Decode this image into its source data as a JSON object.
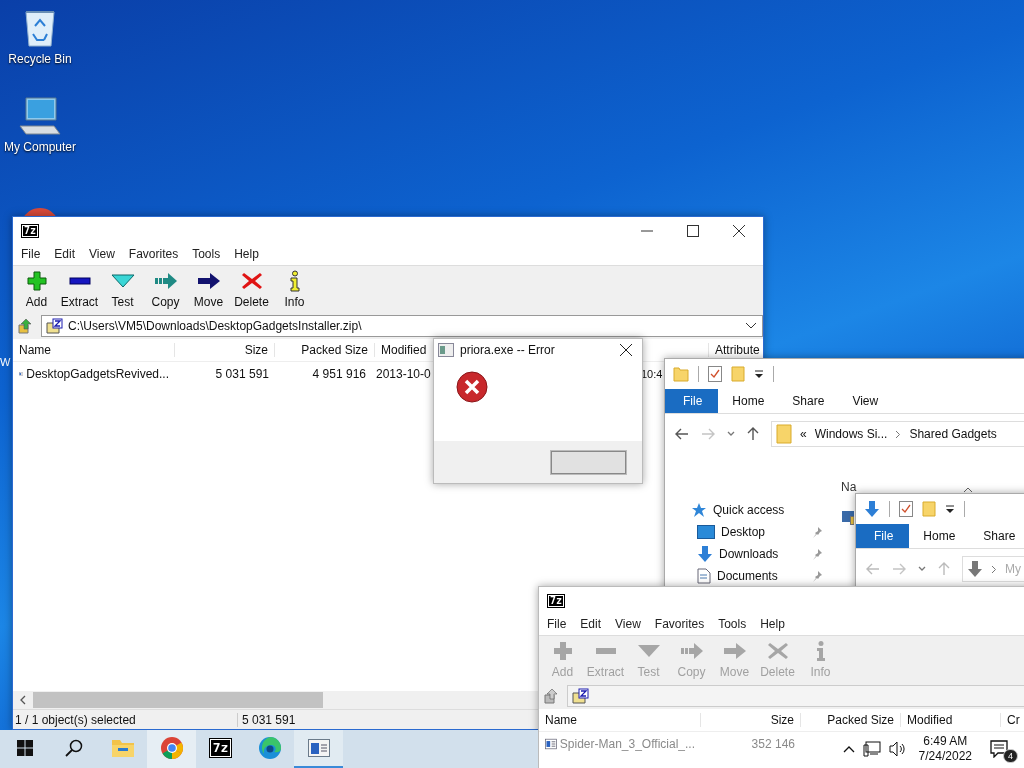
{
  "desktop": {
    "icons": [
      {
        "kind": "recycle",
        "label": "Recycle Bin"
      },
      {
        "kind": "computer",
        "label": "My Computer"
      },
      {
        "kind": "app"
      }
    ],
    "stray_label": "W"
  },
  "archive_window": {
    "logo": "7z",
    "menu": [
      "File",
      "Edit",
      "View",
      "Favorites",
      "Tools",
      "Help"
    ],
    "toolbar": [
      {
        "kind": "add",
        "label": "Add",
        "disabled": false
      },
      {
        "kind": "extract",
        "label": "Extract",
        "disabled": false
      },
      {
        "kind": "test",
        "label": "Test",
        "disabled": false
      },
      {
        "kind": "copy",
        "label": "Copy",
        "disabled": false
      },
      {
        "kind": "move",
        "label": "Move",
        "disabled": false
      },
      {
        "kind": "delete",
        "label": "Delete",
        "disabled": false
      },
      {
        "kind": "info",
        "label": "Info",
        "disabled": false
      }
    ],
    "path": "C:\\Users\\VM5\\Downloads\\DesktopGadgetsInstaller.zip\\",
    "columns": [
      "Name",
      "Size",
      "Packed Size",
      "Modified",
      "Attribute"
    ],
    "rows": [
      {
        "name": "DesktopGadgetsRevived...",
        "size": "5 031 591",
        "packed_size": "4 951 916",
        "modified": "2013-10-0",
        "modified_tail": "10:4"
      }
    ],
    "status": {
      "selection": "1 / 1 object(s) selected",
      "size": "5 031 591"
    }
  },
  "error_dialog": {
    "title": "priora.exe -- Error"
  },
  "explorer_window": {
    "tabs": [
      {
        "label": "File",
        "selected": true
      },
      {
        "label": "Home",
        "selected": false
      },
      {
        "label": "Share",
        "selected": false
      },
      {
        "label": "View",
        "selected": false
      }
    ],
    "overflow": "«",
    "breadcrumb": [
      "Windows Si...",
      "Shared Gadgets"
    ],
    "nav": [
      {
        "kind": "star",
        "label": "Quick access",
        "pinned": false
      },
      {
        "kind": "desktop",
        "label": "Desktop",
        "pinned": true
      },
      {
        "kind": "download",
        "label": "Downloads",
        "pinned": true
      },
      {
        "kind": "document",
        "label": "Documents",
        "pinned": true
      }
    ],
    "column": "Na"
  },
  "explorer_window_2": {
    "tabs": [
      {
        "label": "File",
        "selected": true
      },
      {
        "label": "Home",
        "selected": false
      },
      {
        "label": "Share",
        "selected": false
      }
    ],
    "breadcrumb": [
      "My"
    ]
  },
  "archive_window_2": {
    "logo": "7z",
    "menu": [
      "File",
      "Edit",
      "View",
      "Favorites",
      "Tools",
      "Help"
    ],
    "toolbar": [
      {
        "kind": "add",
        "label": "Add",
        "disabled": true
      },
      {
        "kind": "extract",
        "label": "Extract",
        "disabled": true
      },
      {
        "kind": "test",
        "label": "Test",
        "disabled": true
      },
      {
        "kind": "copy",
        "label": "Copy",
        "disabled": true
      },
      {
        "kind": "move",
        "label": "Move",
        "disabled": true
      },
      {
        "kind": "delete",
        "label": "Delete",
        "disabled": true
      },
      {
        "kind": "info",
        "label": "Info",
        "disabled": true
      }
    ],
    "columns": [
      "Name",
      "Size",
      "Packed Size",
      "Modified",
      "Cr"
    ],
    "rows": [
      {
        "name": "Spider-Man_3_Official_...",
        "size": "352 146"
      }
    ]
  },
  "taskbar": {
    "apps": [
      {
        "kind": "start",
        "hovered": false,
        "running": false
      },
      {
        "kind": "search",
        "hovered": false,
        "running": false
      },
      {
        "kind": "folder",
        "hovered": false,
        "running": false
      },
      {
        "kind": "chrome",
        "hovered": true,
        "running": false
      },
      {
        "kind": "archiver",
        "logo": "7z",
        "hovered": false,
        "running": false
      },
      {
        "kind": "edge",
        "hovered": false,
        "running": false
      },
      {
        "kind": "window",
        "hovered": false,
        "running": true
      }
    ],
    "clock": {
      "time": "6:49 AM",
      "date": "7/24/2022"
    },
    "notifications": "4"
  }
}
